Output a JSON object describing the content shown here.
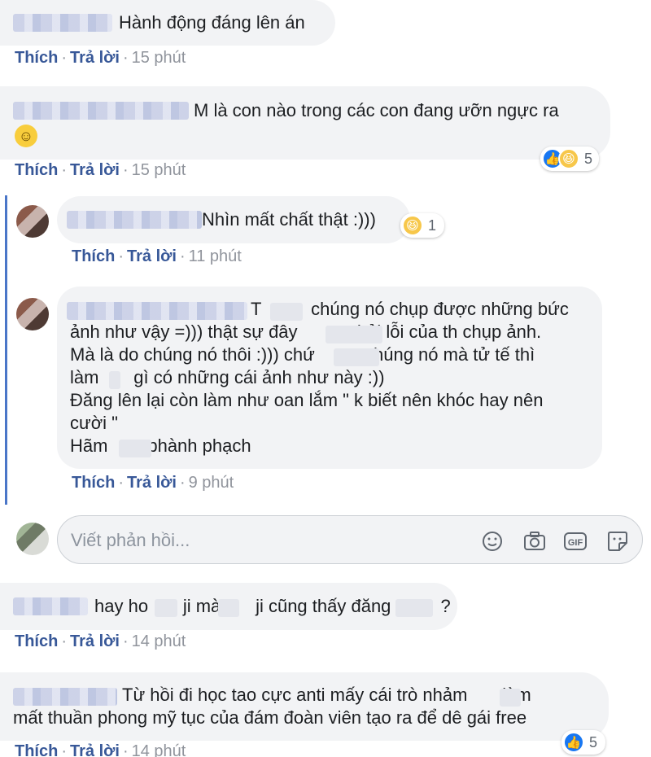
{
  "comments": [
    {
      "text": "Hành động đáng lên án",
      "actions": {
        "like": "Thích",
        "reply": "Trả lời",
        "time": "15 phút"
      }
    },
    {
      "text": "M là con nào trong các con đang ưỡn ngực ra",
      "actions": {
        "like": "Thích",
        "reply": "Trả lời",
        "time": "15 phút"
      },
      "reactions": {
        "count": "5",
        "types": [
          "like-icon",
          "haha-icon"
        ]
      }
    },
    {
      "text": "Nhìn mất chất thật :)))",
      "actions": {
        "like": "Thích",
        "reply": "Trả lời",
        "time": "11 phút"
      },
      "reactions": {
        "count": "1",
        "types": [
          "haha-icon"
        ]
      }
    },
    {
      "lines": [
        "T          chúng nó chụp được những bức",
        "ảnh như vậy =))) thật sự đây          phải lỗi của th chụp ảnh.",
        "Mà là do chúng nó thôi :))) chứ          chúng nó mà tử tế thì",
        "làm       gì có những cái ảnh như này :))",
        "Đăng lên lại còn làm như oan lắm \" k biết nên khóc hay nên",
        "cười \"",
        "Hãm        phành phạch"
      ],
      "actions": {
        "like": "Thích",
        "reply": "Trả lời",
        "time": "9 phút"
      }
    },
    {
      "text": "hay ho       ji mà       ji cũng thấy đăng          ?",
      "actions": {
        "like": "Thích",
        "reply": "Trả lời",
        "time": "14 phút"
      }
    },
    {
      "lines": [
        "Từ hồi đi học tao cực anti mấy cái trò nhảm       làm",
        "mất thuần phong mỹ tục của đám đoàn viên tạo ra để dê gái free"
      ],
      "actions": {
        "like": "Thích",
        "reply": "Trả lời",
        "time": "14 phút"
      },
      "reactions": {
        "count": "5",
        "types": [
          "like-icon"
        ]
      }
    }
  ],
  "reply_box": {
    "placeholder": "Viết phản hồi...",
    "icons": [
      "emoji-icon",
      "camera-icon",
      "gif-icon",
      "sticker-icon"
    ]
  },
  "colors": {
    "link": "#385898",
    "bubble": "#f2f3f5",
    "thread_line": "#4a76c8",
    "like": "#1877f2",
    "haha": "#f7c74a"
  }
}
